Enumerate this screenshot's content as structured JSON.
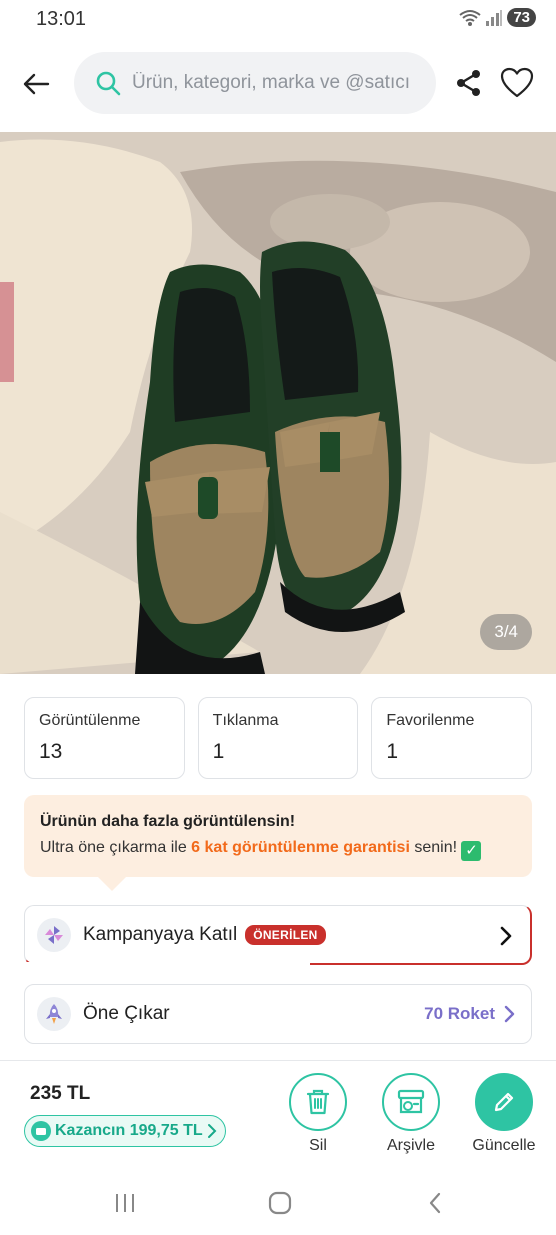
{
  "status_bar": {
    "time": "13:01",
    "battery": "73"
  },
  "header": {
    "search_placeholder": "Ürün, kategori, marka ve @satıcı"
  },
  "image": {
    "counter": "3/4"
  },
  "stats": [
    {
      "label": "Görüntülenme",
      "value": "13"
    },
    {
      "label": "Tıklanma",
      "value": "1"
    },
    {
      "label": "Favorilenme",
      "value": "1"
    }
  ],
  "promo": {
    "title": "Ürünün daha fazla görüntülensin!",
    "text_before": "Ultra öne çıkarma ile ",
    "highlight": "6 kat görüntülenme garantisi",
    "text_after": " senin!"
  },
  "campaign": {
    "label": "Kampanyaya Katıl",
    "badge": "ÖNERİLEN"
  },
  "feature": {
    "label": "Öne Çıkar",
    "cost": "70 Roket"
  },
  "bottom": {
    "price": "235 TL",
    "earnings": "Kazancın 199,75 TL",
    "delete_label": "Sil",
    "archive_label": "Arşivle",
    "update_label": "Güncelle"
  },
  "colors": {
    "accent": "#2ec4a3",
    "badge": "#c9302c",
    "promo_bg": "#fdeee0",
    "promo_highlight": "#f26a1b",
    "roket": "#7a6fc9"
  }
}
